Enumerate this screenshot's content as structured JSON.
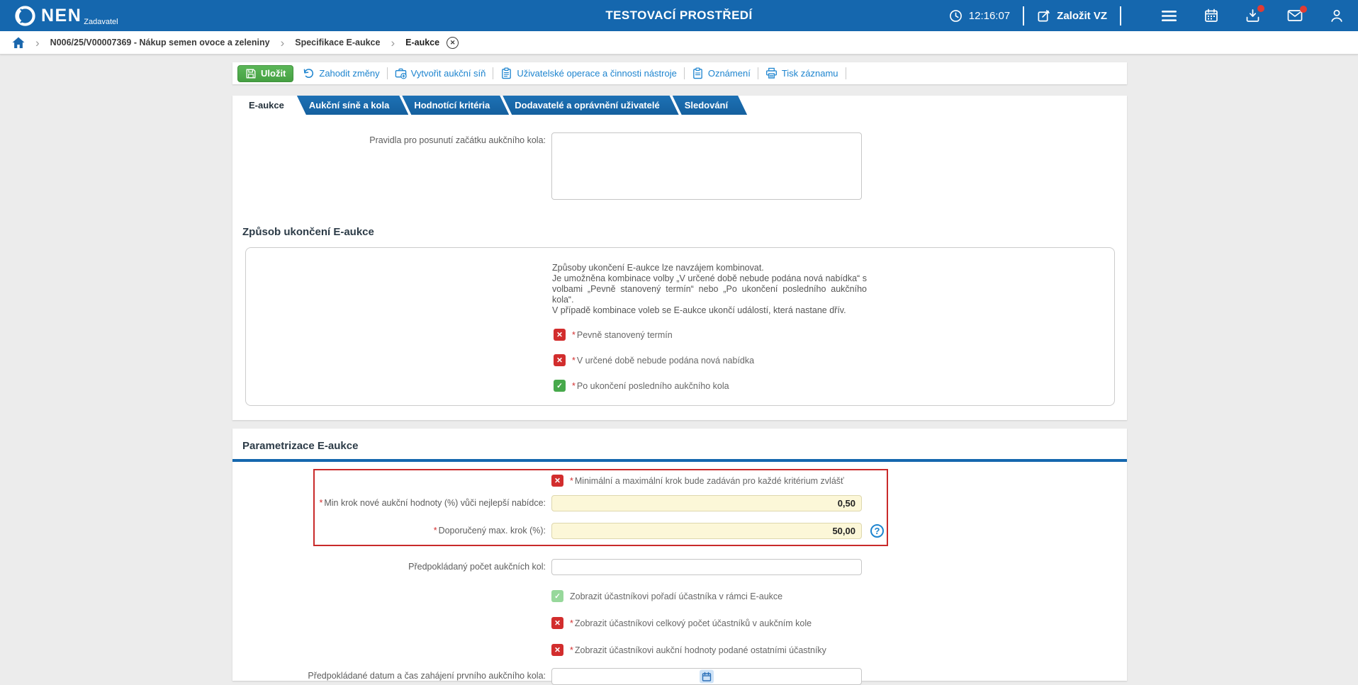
{
  "ui": {
    "required_marker": "*",
    "check_glyph": "✓",
    "cross_glyph": "✕",
    "help_glyph": "?",
    "chevron_glyph": "›",
    "close_glyph": "✕",
    "colors": {
      "header_blue": "#1567ae",
      "link_blue": "#1d84cf",
      "save_green": "#4caf50",
      "error_red": "#d32f2f",
      "checked_green": "#47a94b",
      "checked_green_disabled": "#97d89b",
      "required_field_bg": "#fcf7d8",
      "highlight_border_red": "#c92a2a"
    }
  },
  "header": {
    "brand": "NEN",
    "brand_suffix": "Zadavatel",
    "environment_title": "TESTOVACÍ PROSTŘEDÍ",
    "clock_time": "12:16:07",
    "create_tender_label": "Založit VZ"
  },
  "breadcrumb": {
    "items": [
      "N006/25/V00007369 - Nákup semen ovoce a zeleniny",
      "Specifikace E-aukce",
      "E-aukce"
    ]
  },
  "toolbar": {
    "save_label": "Uložit",
    "discard_label": "Zahodit změny",
    "create_auction_room_label": "Vytvořit aukční síň",
    "user_operations_label": "Uživatelské operace a činnosti nástroje",
    "notifications_label": "Oznámení",
    "print_label": "Tisk záznamu"
  },
  "tabs": [
    {
      "label": "E-aukce",
      "active": true
    },
    {
      "label": "Aukční síně a kola",
      "active": false
    },
    {
      "label": "Hodnotící kritéria",
      "active": false
    },
    {
      "label": "Dodavatelé a oprávnění uživatelé",
      "active": false
    },
    {
      "label": "Sledování",
      "active": false
    }
  ],
  "form": {
    "shift_rules": {
      "label": "Pravidla pro posunutí začátku aukčního kola:",
      "value": ""
    },
    "termination": {
      "heading": "Způsob ukončení E-aukce",
      "info_line1": "Způsoby ukončení E-aukce lze navzájem kombinovat.",
      "info_line2": "Je umožněna kombinace volby „V určené době nebude podána nová nabídka“ s volbami „Pevně stanovený termín“ nebo „Po ukončení posledního aukčního kola“.",
      "info_line3": "V případě kombinace voleb se E-aukce ukončí událostí, která nastane dřív.",
      "options": [
        {
          "label": "Pevně stanovený termín",
          "required": true,
          "checked": false
        },
        {
          "label": "V určené době nebude podána nová nabídka",
          "required": true,
          "checked": false
        },
        {
          "label": "Po ukončení posledního aukčního kola",
          "required": true,
          "checked": true
        }
      ]
    },
    "parameters": {
      "heading": "Parametrizace E-aukce",
      "step_per_criterion": {
        "label": "Minimální a maximální krok bude zadáván pro každé kritérium zvlášť",
        "required": true,
        "checked": false
      },
      "min_step": {
        "label": "Min krok nové aukční hodnoty (%) vůči nejlepší nabídce:",
        "value": "0,50",
        "required": true
      },
      "max_step": {
        "label": "Doporučený max. krok (%):",
        "value": "50,00",
        "required": true
      },
      "expected_rounds": {
        "label": "Předpokládaný počet aukčních kol:",
        "value": ""
      },
      "show_participant_rank": {
        "label": "Zobrazit účastníkovi pořadí účastníka v rámci E-aukce",
        "checked": true,
        "disabled": true
      },
      "show_participant_count": {
        "label": "Zobrazit účastníkovi celkový počet účastníků v aukčním kole",
        "required": true,
        "checked": false
      },
      "show_other_bids": {
        "label": "Zobrazit účastníkovi aukční hodnoty podané ostatními účastníky",
        "required": true,
        "checked": false
      },
      "first_round_start": {
        "label": "Předpokládané datum a čas zahájení prvního aukčního kola:",
        "value": ""
      }
    }
  }
}
